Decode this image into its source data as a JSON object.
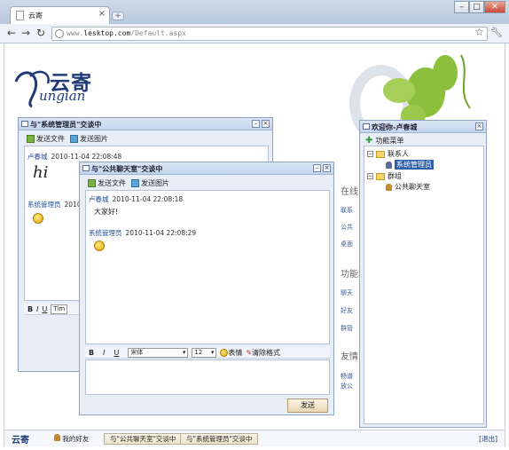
{
  "browser": {
    "tab_title": "云寄",
    "url_scheme": "www.",
    "url_host": "lesktop.com",
    "url_path": "/Default.aspx"
  },
  "logo": {
    "text": "云寄",
    "sub": "ungian"
  },
  "page_side": {
    "online_heading": "在线",
    "links1": [
      "联系",
      "公共",
      "桌面"
    ],
    "func_heading": "功能",
    "links2": [
      "聊天",
      "好友",
      "群管"
    ],
    "friend_heading": "友情",
    "links3": [
      "畅谱",
      "放公"
    ]
  },
  "win1": {
    "title": "与\"系统管理员\"交谈中",
    "send_file": "发送文件",
    "send_image": "发送图片",
    "msg1_sender": "卢春城",
    "msg1_time": "2010-11-04 22:08:48",
    "msg1_text": "hi",
    "msg2_sender": "系统管理员",
    "msg2_time": "2010-1",
    "font_partial": "Tim"
  },
  "win2": {
    "title": "与\"公共聊天室\"交谈中",
    "send_file": "发送文件",
    "send_image": "发送图片",
    "msg1_sender": "卢春城",
    "msg1_time": "2010-11-04 22:08:18",
    "msg1_text": "大家好!",
    "msg2_sender": "系统管理员",
    "msg2_time": "2010-11-04 22:08:29",
    "bold": "B",
    "italic": "I",
    "underline": "U",
    "font": "宋体",
    "size": "12",
    "emoji_label": "表情",
    "clear_label": "清除格式",
    "send_label": "发送"
  },
  "contacts": {
    "title": "欢迎你-卢春城",
    "menu": "功能菜单",
    "group_contacts": "联系人",
    "contact1": "系统管理员",
    "group_groups": "群组",
    "group1": "公共聊天室"
  },
  "footer": {
    "logo": "云寄",
    "friends": "我的好友",
    "task1": "与\"公共聊天室\"交谈中",
    "task2": "与\"系统管理员\"交谈中",
    "logout": "[退出]"
  }
}
